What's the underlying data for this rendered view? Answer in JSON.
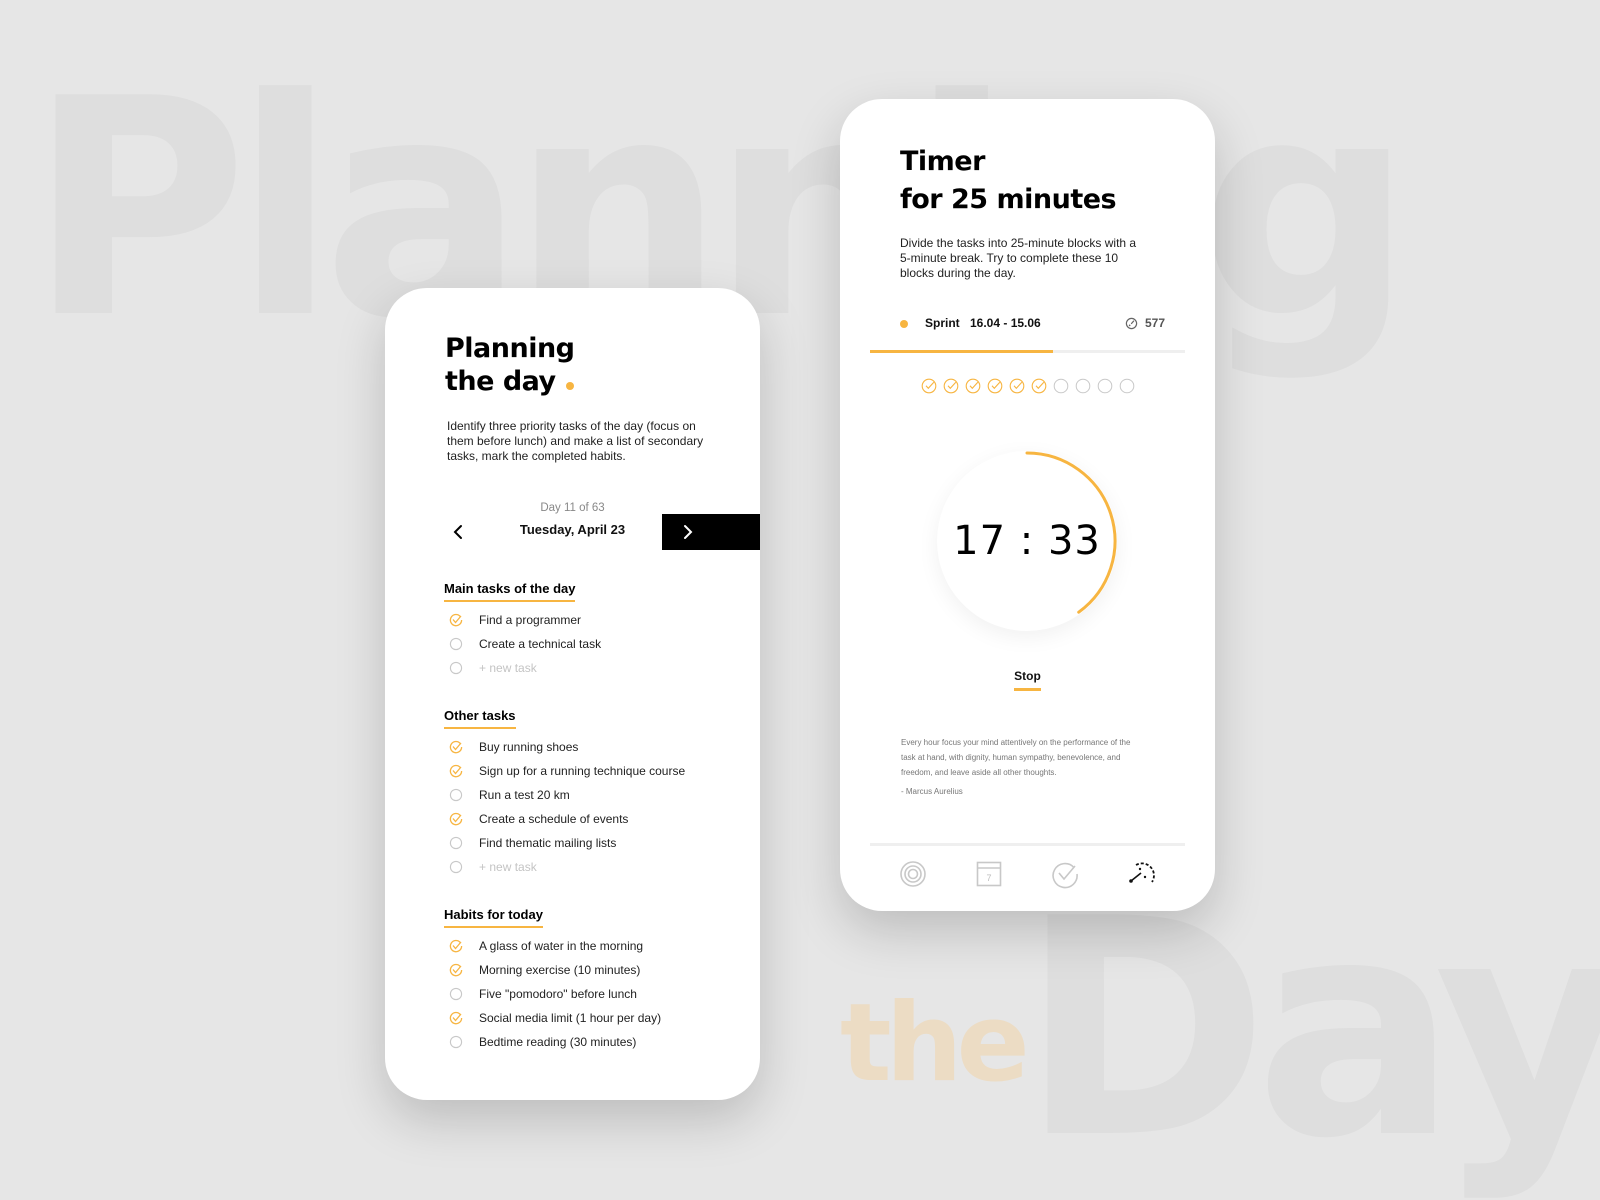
{
  "background": {
    "word_planning": "Planning",
    "word_the": "the",
    "word_day": "Day"
  },
  "colors": {
    "accent": "#f7b541",
    "background": "#e6e6e6",
    "muted": "#c4c4c4"
  },
  "planning_screen": {
    "title_line1": "Planning",
    "title_line2": "the day",
    "description": "Identify three priority tasks of the day (focus on them before lunch) and make a list of secondary tasks, mark the completed habits.",
    "day_counter": "Day 11 of 63",
    "date": "Tuesday, April 23",
    "prev_icon": "chevron-left-icon",
    "next_icon": "chevron-right-icon",
    "sections": [
      {
        "title": "Main tasks of the day",
        "items": [
          {
            "label": "Find a programmer",
            "done": true
          },
          {
            "label": "Create a technical task",
            "done": false
          },
          {
            "label": "+ new task",
            "done": false,
            "placeholder": true
          }
        ]
      },
      {
        "title": "Other tasks",
        "items": [
          {
            "label": "Buy running shoes",
            "done": true
          },
          {
            "label": "Sign up for a running technique course",
            "done": true
          },
          {
            "label": "Run a test 20 km",
            "done": false
          },
          {
            "label": "Create a schedule of events",
            "done": true
          },
          {
            "label": "Find thematic mailing lists",
            "done": false
          },
          {
            "label": "+ new task",
            "done": false,
            "placeholder": true
          }
        ]
      },
      {
        "title": "Habits for today",
        "items": [
          {
            "label": "A glass of water in the morning",
            "done": true
          },
          {
            "label": "Morning exercise (10 minutes)",
            "done": true
          },
          {
            "label": "Five \"pomodoro\" before lunch",
            "done": false
          },
          {
            "label": "Social media limit (1 hour per day)",
            "done": true
          },
          {
            "label": "Bedtime reading (30 minutes)",
            "done": false
          }
        ]
      }
    ]
  },
  "timer_screen": {
    "title_line1": "Timer",
    "title_line2": "for 25 minutes",
    "description": "Divide the tasks into 25-minute blocks with a 5-minute break. Try to complete these 10 blocks during the day.",
    "sprint_label": "Sprint",
    "sprint_dates": "16.04 - 15.06",
    "sprint_count": "577",
    "sprint_icon": "gauge-icon",
    "sprint_progress": 0.58,
    "blocks_total": 10,
    "blocks_done": 6,
    "time_display": "17 : 33",
    "timer_progress": 0.4,
    "stop_label": "Stop",
    "quote": "Every hour focus your mind attentively on the performance of the task at hand, with dignity, human sympathy, benevolence, and freedom, and leave aside all other thoughts.",
    "quote_author": "- Marcus Aurelius",
    "tabs": [
      {
        "name": "goals",
        "icon": "target-icon",
        "active": false
      },
      {
        "name": "calendar",
        "icon": "calendar-icon",
        "calendar_day": "7",
        "active": false
      },
      {
        "name": "tasks",
        "icon": "check-circle-icon",
        "active": false
      },
      {
        "name": "timer",
        "icon": "timer-icon",
        "active": true
      }
    ]
  }
}
